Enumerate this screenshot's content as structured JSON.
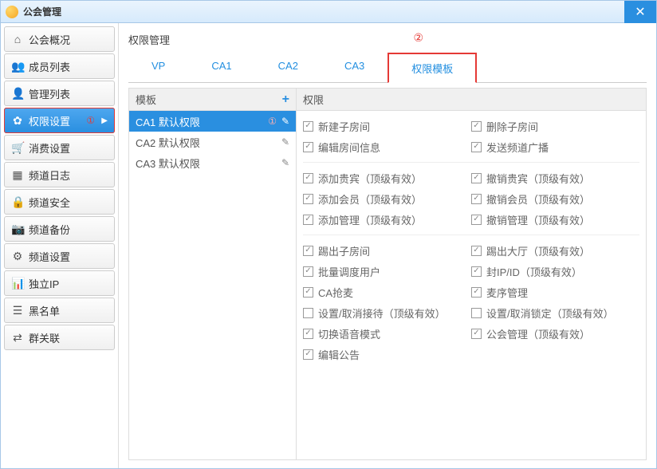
{
  "window": {
    "title": "公会管理",
    "close": "✕"
  },
  "markers": {
    "m1": "①",
    "m2": "②"
  },
  "sidebar": [
    {
      "icon": "⌂",
      "label": "公会概况"
    },
    {
      "icon": "👥",
      "label": "成员列表"
    },
    {
      "icon": "👤",
      "label": "管理列表"
    },
    {
      "icon": "✿",
      "label": "权限设置",
      "active": true,
      "highlight": true,
      "arrow": "▶"
    },
    {
      "icon": "🛒",
      "label": "消费设置"
    },
    {
      "icon": "▦",
      "label": "频道日志"
    },
    {
      "icon": "🔒",
      "label": "频道安全"
    },
    {
      "icon": "📷",
      "label": "频道备份"
    },
    {
      "icon": "⚙",
      "label": "频道设置"
    },
    {
      "icon": "📊",
      "label": "独立IP"
    },
    {
      "icon": "☰",
      "label": "黑名单"
    },
    {
      "icon": "⇄",
      "label": "群关联"
    }
  ],
  "page": {
    "title": "权限管理"
  },
  "tabs": [
    {
      "label": "VP"
    },
    {
      "label": "CA1"
    },
    {
      "label": "CA2"
    },
    {
      "label": "CA3"
    },
    {
      "label": "权限模板",
      "active": true
    }
  ],
  "templates": {
    "header": "模板",
    "items": [
      {
        "label": "CA1 默认权限",
        "selected": true
      },
      {
        "label": "CA2 默认权限"
      },
      {
        "label": "CA3 默认权限"
      }
    ]
  },
  "permissions": {
    "header": "权限",
    "groups": [
      {
        "sep": true,
        "items": [
          {
            "label": "新建子房间",
            "checked": true
          },
          {
            "label": "删除子房间",
            "checked": true
          },
          {
            "label": "编辑房间信息",
            "checked": true
          },
          {
            "label": "发送频道广播",
            "checked": true
          }
        ]
      },
      {
        "sep": true,
        "items": [
          {
            "label": "添加贵宾（顶级有效）",
            "checked": true
          },
          {
            "label": "撤销贵宾（顶级有效）",
            "checked": true
          },
          {
            "label": "添加会员（顶级有效）",
            "checked": true
          },
          {
            "label": "撤销会员（顶级有效）",
            "checked": true
          },
          {
            "label": "添加管理（顶级有效）",
            "checked": true
          },
          {
            "label": "撤销管理（顶级有效）",
            "checked": true
          }
        ]
      },
      {
        "sep": false,
        "items": [
          {
            "label": "踢出子房间",
            "checked": true
          },
          {
            "label": "踢出大厅（顶级有效）",
            "checked": true
          },
          {
            "label": "批量调度用户",
            "checked": true
          },
          {
            "label": "封IP/ID（顶级有效）",
            "checked": true
          },
          {
            "label": "CA抢麦",
            "checked": true
          },
          {
            "label": "麦序管理",
            "checked": true
          },
          {
            "label": "设置/取消接待（顶级有效）",
            "checked": false
          },
          {
            "label": "设置/取消锁定（顶级有效）",
            "checked": false
          },
          {
            "label": "切换语音模式",
            "checked": true
          },
          {
            "label": "公会管理（顶级有效）",
            "checked": true
          },
          {
            "label": "编辑公告",
            "checked": true
          }
        ]
      }
    ]
  }
}
